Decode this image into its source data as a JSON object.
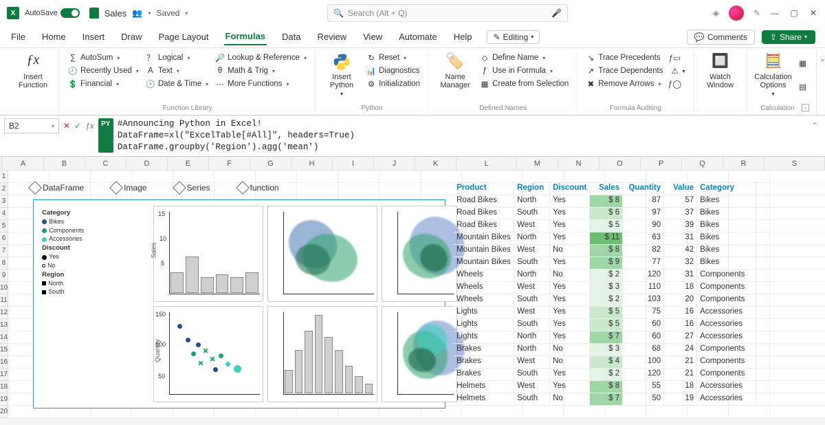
{
  "titlebar": {
    "autosave": "AutoSave",
    "doc_name": "Sales",
    "saved": "Saved",
    "search_placeholder": "Search (Alt + Q)"
  },
  "tabs": [
    "File",
    "Home",
    "Insert",
    "Draw",
    "Page Layout",
    "Formulas",
    "Data",
    "Review",
    "View",
    "Automate",
    "Help"
  ],
  "active_tab": "Formulas",
  "editing_label": "Editing",
  "comments_label": "Comments",
  "share_label": "Share",
  "ribbon": {
    "insert_function": "Insert\nFunction",
    "fn_library": {
      "autosum": "AutoSum",
      "recently": "Recently Used",
      "financial": "Financial",
      "logical": "Logical",
      "text": "Text",
      "date": "Date & Time",
      "lookup": "Lookup & Reference",
      "math": "Math & Trig",
      "more": "More Functions",
      "group": "Function Library"
    },
    "python": {
      "insert": "Insert\nPython",
      "reset": "Reset",
      "diag": "Diagnostics",
      "init": "Initialization",
      "group": "Python"
    },
    "names": {
      "mgr": "Name\nManager",
      "define": "Define Name",
      "use": "Use in Formula",
      "create": "Create from Selection",
      "group": "Defined Names"
    },
    "audit": {
      "prec": "Trace Precedents",
      "dep": "Trace Dependents",
      "remove": "Remove Arrows",
      "group": "Formula Auditing"
    },
    "watch": "Watch\nWindow",
    "calc": "Calculation\nOptions",
    "calc_group": "Calculation"
  },
  "namebox": "B2",
  "py_label": "PY",
  "code_line1": "#Announcing Python in Excel!",
  "code_line2": "DataFrame=xl(\"ExcelTable[#All]\", headers=True)",
  "code_line3": "DataFrame.groupby('Region').agg('mean')",
  "columns": [
    "A",
    "B",
    "C",
    "D",
    "E",
    "F",
    "G",
    "H",
    "I",
    "J",
    "K",
    "L",
    "M",
    "N",
    "O",
    "P",
    "Q",
    "R",
    "S"
  ],
  "py_headers": {
    "df": "DataFrame",
    "img": "Image",
    "series": "Series",
    "fn": "function"
  },
  "table": {
    "headers": [
      "Product",
      "Region",
      "Discount",
      "Sales",
      "Quantity",
      "Value",
      "Category"
    ],
    "rows": [
      [
        "Road Bikes",
        "North",
        "Yes",
        "$   8",
        "87",
        "57",
        "Bikes"
      ],
      [
        "Road Bikes",
        "South",
        "Yes",
        "$   6",
        "97",
        "37",
        "Bikes"
      ],
      [
        "Road Bikes",
        "West",
        "Yes",
        "$   5",
        "90",
        "39",
        "Bikes"
      ],
      [
        "Mountain Bikes",
        "North",
        "Yes",
        "$  11",
        "63",
        "31",
        "Bikes"
      ],
      [
        "Mountain Bikes",
        "West",
        "No",
        "$   8",
        "82",
        "42",
        "Bikes"
      ],
      [
        "Mountain Bikes",
        "South",
        "Yes",
        "$   9",
        "77",
        "32",
        "Bikes"
      ],
      [
        "Wheels",
        "North",
        "No",
        "$   2",
        "120",
        "31",
        "Components"
      ],
      [
        "Wheels",
        "West",
        "Yes",
        "$   3",
        "110",
        "18",
        "Components"
      ],
      [
        "Wheels",
        "South",
        "Yes",
        "$   2",
        "103",
        "20",
        "Components"
      ],
      [
        "Lights",
        "West",
        "Yes",
        "$   5",
        "75",
        "16",
        "Accessories"
      ],
      [
        "Lights",
        "South",
        "Yes",
        "$   5",
        "60",
        "16",
        "Accessories"
      ],
      [
        "Lights",
        "North",
        "Yes",
        "$   7",
        "60",
        "27",
        "Accessories"
      ],
      [
        "Brakes",
        "North",
        "No",
        "$   3",
        "68",
        "24",
        "Components"
      ],
      [
        "Brakes",
        "West",
        "No",
        "$   4",
        "100",
        "21",
        "Components"
      ],
      [
        "Brakes",
        "South",
        "Yes",
        "$   2",
        "120",
        "21",
        "Components"
      ],
      [
        "Helmets",
        "West",
        "Yes",
        "$   8",
        "55",
        "18",
        "Accessories"
      ],
      [
        "Helmets",
        "South",
        "No",
        "$   7",
        "50",
        "19",
        "Accessories"
      ]
    ]
  },
  "legend": {
    "cat": "Category",
    "bikes": "Bikes",
    "comp": "Components",
    "acc": "Accessories",
    "disc": "Discount",
    "yes": "Yes",
    "no": "No",
    "reg": "Region",
    "north": "North",
    "south": "South"
  },
  "chart_data": [
    {
      "type": "bar",
      "ylabel": "Sales",
      "ylim": [
        0,
        15
      ],
      "values": [
        4,
        7,
        3,
        3.5,
        3,
        4
      ]
    },
    {
      "type": "area",
      "note": "density blobs green+blue"
    },
    {
      "type": "area",
      "note": "density blobs green+blue variant"
    },
    {
      "type": "scatter",
      "ylabel": "Quantity",
      "ylim": [
        50,
        150
      ],
      "series": [
        {
          "name": "Bikes",
          "color": "#2a4a9a"
        },
        {
          "name": "Components",
          "color": "#1aa36b"
        },
        {
          "name": "Accessories",
          "color": "#3dd0c0"
        }
      ]
    },
    {
      "type": "bar",
      "values": [
        30,
        55,
        80,
        100,
        72,
        55,
        35,
        22,
        12
      ]
    },
    {
      "type": "area",
      "note": "density blobs green+blue variant2"
    }
  ]
}
